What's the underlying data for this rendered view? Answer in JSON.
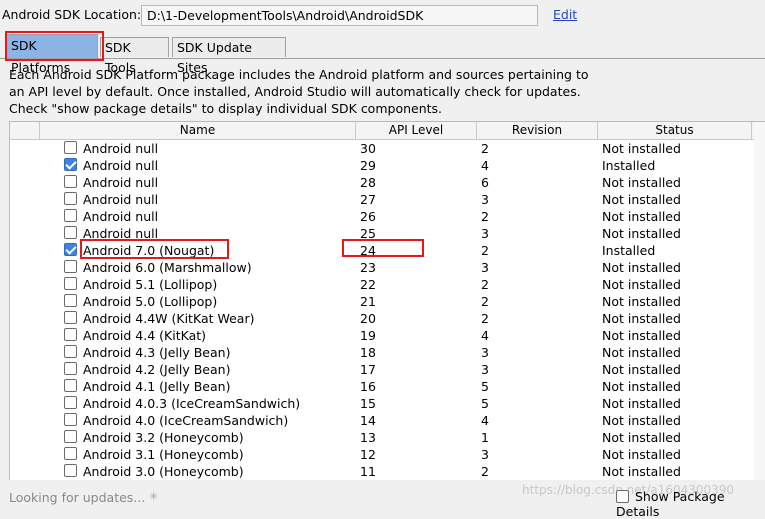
{
  "sdk_location": {
    "label": "Android SDK Location:",
    "value": "D:\\1-DevelopmentTools\\Android\\AndroidSDK",
    "edit_link": "Edit"
  },
  "tabs": [
    {
      "label": "SDK Platforms",
      "active": true
    },
    {
      "label": "SDK Tools",
      "active": false
    },
    {
      "label": "SDK Update Sites",
      "active": false
    }
  ],
  "description": "Each Android SDK Platform package includes the Android platform and sources pertaining to an API level by default. Once installed, Android Studio will automatically check for updates. Check \"show package details\" to display individual SDK components.",
  "table": {
    "columns": [
      "Name",
      "API Level",
      "Revision",
      "Status"
    ],
    "rows": [
      {
        "name": "Android null",
        "api": "30",
        "rev": "2",
        "status": "Not installed",
        "checked": false
      },
      {
        "name": "Android null",
        "api": "29",
        "rev": "4",
        "status": "Installed",
        "checked": true
      },
      {
        "name": "Android null",
        "api": "28",
        "rev": "6",
        "status": "Not installed",
        "checked": false
      },
      {
        "name": "Android null",
        "api": "27",
        "rev": "3",
        "status": "Not installed",
        "checked": false
      },
      {
        "name": "Android null",
        "api": "26",
        "rev": "2",
        "status": "Not installed",
        "checked": false
      },
      {
        "name": "Android null",
        "api": "25",
        "rev": "3",
        "status": "Not installed",
        "checked": false
      },
      {
        "name": "Android 7.0 (Nougat)",
        "api": "24",
        "rev": "2",
        "status": "Installed",
        "checked": true
      },
      {
        "name": "Android 6.0 (Marshmallow)",
        "api": "23",
        "rev": "3",
        "status": "Not installed",
        "checked": false
      },
      {
        "name": "Android 5.1 (Lollipop)",
        "api": "22",
        "rev": "2",
        "status": "Not installed",
        "checked": false
      },
      {
        "name": "Android 5.0 (Lollipop)",
        "api": "21",
        "rev": "2",
        "status": "Not installed",
        "checked": false
      },
      {
        "name": "Android 4.4W (KitKat Wear)",
        "api": "20",
        "rev": "2",
        "status": "Not installed",
        "checked": false
      },
      {
        "name": "Android 4.4 (KitKat)",
        "api": "19",
        "rev": "4",
        "status": "Not installed",
        "checked": false
      },
      {
        "name": "Android 4.3 (Jelly Bean)",
        "api": "18",
        "rev": "3",
        "status": "Not installed",
        "checked": false
      },
      {
        "name": "Android 4.2 (Jelly Bean)",
        "api": "17",
        "rev": "3",
        "status": "Not installed",
        "checked": false
      },
      {
        "name": "Android 4.1 (Jelly Bean)",
        "api": "16",
        "rev": "5",
        "status": "Not installed",
        "checked": false
      },
      {
        "name": "Android 4.0.3 (IceCreamSandwich)",
        "api": "15",
        "rev": "5",
        "status": "Not installed",
        "checked": false
      },
      {
        "name": "Android 4.0 (IceCreamSandwich)",
        "api": "14",
        "rev": "4",
        "status": "Not installed",
        "checked": false
      },
      {
        "name": "Android 3.2 (Honeycomb)",
        "api": "13",
        "rev": "1",
        "status": "Not installed",
        "checked": false
      },
      {
        "name": "Android 3.1 (Honeycomb)",
        "api": "12",
        "rev": "3",
        "status": "Not installed",
        "checked": false
      },
      {
        "name": "Android 3.0 (Honeycomb)",
        "api": "11",
        "rev": "2",
        "status": "Not installed",
        "checked": false
      }
    ]
  },
  "footer": {
    "status": "Looking for updates...",
    "show_details_label": "Show Package Details",
    "watermark": "https://blog.csdn.net/a1604300390"
  },
  "colors": {
    "highlight": "#e51717",
    "active_tab": "#8db4e6",
    "checkbox_checked": "#3f82e0",
    "link": "#2146c8"
  }
}
